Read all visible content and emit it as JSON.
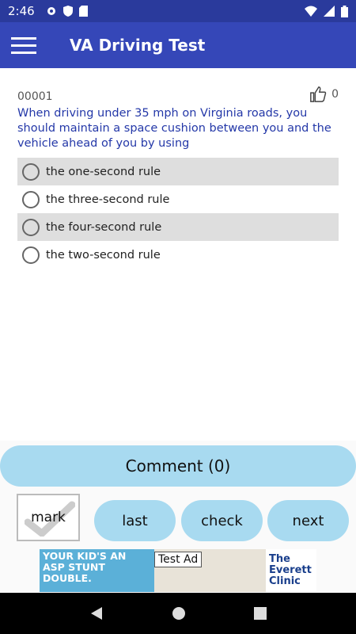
{
  "status": {
    "time": "2:46"
  },
  "app": {
    "title": "VA Driving Test"
  },
  "question": {
    "number": "00001",
    "likes": "0",
    "text": "When driving under 35 mph on Virginia roads, you should maintain a space cushion between you and the vehicle ahead of you by using",
    "options": [
      {
        "label": "the one-second rule"
      },
      {
        "label": "the three-second rule"
      },
      {
        "label": "the four-second rule"
      },
      {
        "label": "the two-second rule"
      }
    ]
  },
  "buttons": {
    "comment": "Comment (0)",
    "mark": "mark",
    "last": "last",
    "check": "check",
    "next": "next"
  },
  "ad": {
    "left_text": "YOUR KID'S AN ASP STUNT DOUBLE.",
    "tag": "Test Ad",
    "brand": "The Everett Clinic"
  },
  "colors": {
    "primary": "#3547b8",
    "status": "#2a3a9c",
    "accent": "#a8daf0",
    "question_text": "#2438a8"
  }
}
